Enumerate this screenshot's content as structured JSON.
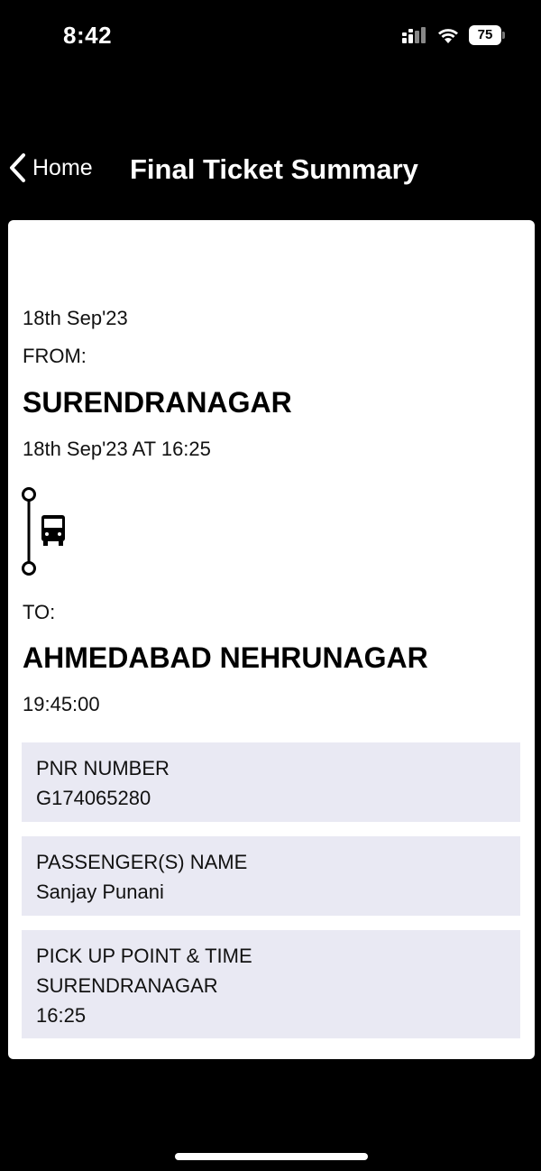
{
  "status_bar": {
    "time": "8:42",
    "battery": "75",
    "icons": [
      "signal-icon",
      "wifi-icon",
      "battery-icon"
    ]
  },
  "nav": {
    "back_label": "Home",
    "back_icon": "chevron-left-icon",
    "title": "Final Ticket Summary"
  },
  "ticket": {
    "date": "18th Sep'23",
    "from_label": "FROM:",
    "from_city": "SURENDRANAGAR",
    "departure": "18th Sep'23 AT 16:25",
    "route_icon": "bus-icon",
    "to_label": "TO:",
    "to_city": "AHMEDABAD NEHRUNAGAR",
    "arrival": "19:45:00"
  },
  "details": {
    "pnr": {
      "label": "PNR NUMBER",
      "value": "G174065280"
    },
    "passenger": {
      "label": "PASSENGER(S) NAME",
      "value": "Sanjay Punani"
    },
    "pickup": {
      "label": "PICK UP POINT & TIME",
      "place": "SURENDRANAGAR",
      "time": "16:25"
    }
  },
  "colors": {
    "background": "#000000",
    "card": "#ffffff",
    "info_box": "#e9e9f3"
  }
}
